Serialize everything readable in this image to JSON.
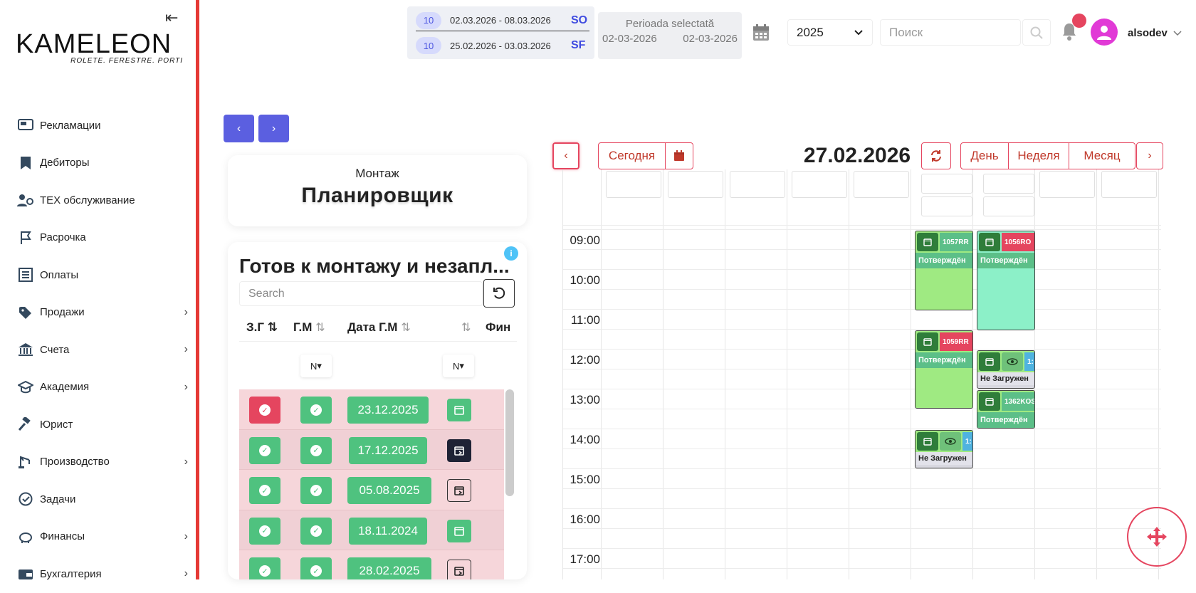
{
  "sidebar": {
    "logo_brand": "KAMELEON",
    "logo_tagline": "ROLETE. FERESTRE. PORTI",
    "items": [
      {
        "label": "Рекламации",
        "icon": "monitor-icon",
        "chevron": false
      },
      {
        "label": "Дебиторы",
        "icon": "bookmark-icon",
        "chevron": false
      },
      {
        "label": "ТЕХ обслуживание",
        "icon": "users-gear-icon",
        "chevron": false
      },
      {
        "label": "Расрочка",
        "icon": "flag-icon",
        "chevron": false
      },
      {
        "label": "Оплаты",
        "icon": "list-icon",
        "chevron": false
      },
      {
        "label": "Продажи",
        "icon": "tag-icon",
        "chevron": true
      },
      {
        "label": "Счета",
        "icon": "bank-icon",
        "chevron": true
      },
      {
        "label": "Академия",
        "icon": "graduation-icon",
        "chevron": true
      },
      {
        "label": "Юрист",
        "icon": "gavel-icon",
        "chevron": false
      },
      {
        "label": "Производство",
        "icon": "crane-icon",
        "chevron": true
      },
      {
        "label": "Задачи",
        "icon": "check-circle-icon",
        "chevron": false
      },
      {
        "label": "Финансы",
        "icon": "piggy-bank-icon",
        "chevron": true
      },
      {
        "label": "Бухгалтерия",
        "icon": "wallet-icon",
        "chevron": true
      }
    ]
  },
  "topbar": {
    "period_rows": [
      {
        "badge": "10",
        "dates": "02.03.2026 - 08.03.2026",
        "code": "SO"
      },
      {
        "badge": "10",
        "dates": "25.02.2026 - 03.03.2026",
        "code": "SF"
      }
    ],
    "selected_period_title": "Perioada selectată",
    "selected_from": "02-03-2026",
    "selected_to": "02-03-2026",
    "year": "2025",
    "search_placeholder": "Поиск",
    "username": "alsodev"
  },
  "planner": {
    "subtitle": "Монтаж",
    "title": "Планировщик"
  },
  "list": {
    "title": "Готов к монтажу и незапл...",
    "search_placeholder": "Search",
    "columns": [
      "З.Г",
      "Г.М",
      "Дата Г.М",
      "Фин"
    ],
    "filter_label": "Ν",
    "rows": [
      {
        "zg": "red",
        "date": "23.12.2025",
        "cal": "green"
      },
      {
        "zg": "green",
        "date": "17.12.2025",
        "cal": "dark"
      },
      {
        "zg": "green",
        "date": "05.08.2025",
        "cal": "outline"
      },
      {
        "zg": "green",
        "date": "18.11.2024",
        "cal": "green"
      },
      {
        "zg": "green",
        "date": "28.02.2025",
        "cal": "outline"
      }
    ]
  },
  "calendar": {
    "today_label": "Сегодня",
    "current_date": "27.02.2026",
    "views": [
      "День",
      "Неделя",
      "Месяц"
    ],
    "times": [
      "09:00",
      "10:00",
      "11:00",
      "12:00",
      "13:00",
      "14:00",
      "15:00",
      "16:00",
      "17:00"
    ],
    "events": [
      {
        "code": "1057RR",
        "status": "Потверждён"
      },
      {
        "code": "1056RO",
        "status": "Потверждён"
      },
      {
        "code": "1059RR",
        "status": "Потверждён"
      },
      {
        "code": "1:",
        "status": "Не Загружен"
      },
      {
        "code": "1362KOS",
        "status": "Потверждён"
      },
      {
        "code": "1:",
        "status": "Не Загружен"
      }
    ],
    "colors": {
      "accent": "#e5455f",
      "event_green": "#9fea82",
      "event_mint": "#8cf0c8",
      "status_green": "#5cbf88",
      "code_red": "#e5455f",
      "code_green": "#5cbf88"
    }
  }
}
